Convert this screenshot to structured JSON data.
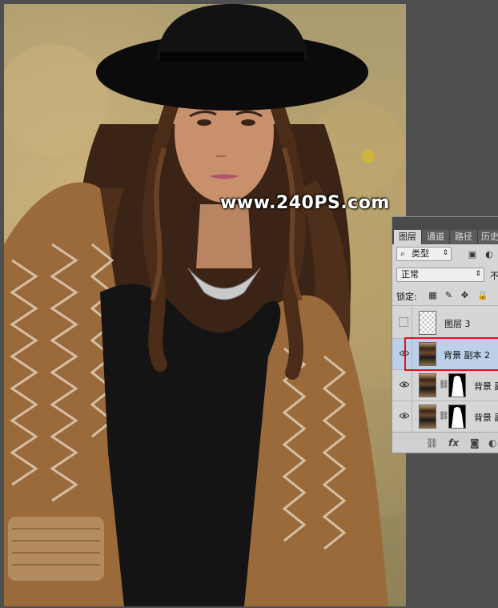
{
  "watermark": {
    "text": "www.240PS.com"
  },
  "layers_panel": {
    "tabs": [
      "图层",
      "通道",
      "路径",
      "历史"
    ],
    "active_tab": "图层",
    "filter": {
      "icon": "search-icon",
      "label": "类型"
    },
    "blend_mode": "正常",
    "opacity_label": "不",
    "lock_label": "锁定:",
    "lock_icons": [
      "lock-transparent-icon",
      "lock-paint-icon",
      "lock-move-icon",
      "lock-all-icon"
    ],
    "layers": [
      {
        "name": "图层 3",
        "visible": false,
        "thumbnail": "transparent",
        "has_mask": false,
        "selected": false
      },
      {
        "name": "背景 副本 2",
        "visible": true,
        "thumbnail": "photo",
        "has_mask": false,
        "selected": true
      },
      {
        "name": "背景 副",
        "visible": true,
        "thumbnail": "photo",
        "has_mask": true,
        "selected": false
      },
      {
        "name": "背景 副",
        "visible": true,
        "thumbnail": "photo",
        "has_mask": true,
        "selected": false
      }
    ],
    "footer_icons": [
      "link-icon",
      "fx-icon",
      "mask-icon",
      "adjustment-icon"
    ],
    "footer_fx": "fx",
    "colors": {
      "selection_highlight": "#e0141b",
      "selected_row": "#bcd0ea"
    }
  }
}
